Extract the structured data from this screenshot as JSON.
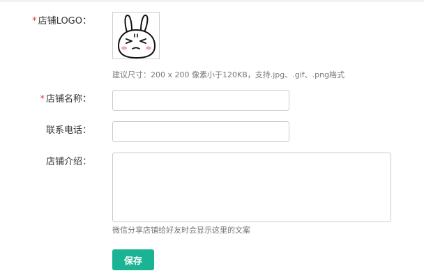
{
  "form": {
    "logo": {
      "required_mark": "*",
      "label": "店铺LOGO：",
      "hint": "建议尺寸：200 x 200 像素小于120KB，支持.jpg、.gif、.png格式"
    },
    "shop_name": {
      "required_mark": "*",
      "label": "店铺名称：",
      "value": "",
      "placeholder": ""
    },
    "phone": {
      "label": "联系电话：",
      "value": "",
      "placeholder": ""
    },
    "intro": {
      "label": "店铺介绍：",
      "value": "",
      "hint": "微信分享店铺给好友时会显示这里的文案"
    },
    "save_label": "保存"
  },
  "colors": {
    "accent": "#1ab394",
    "required": "#e4393c"
  }
}
